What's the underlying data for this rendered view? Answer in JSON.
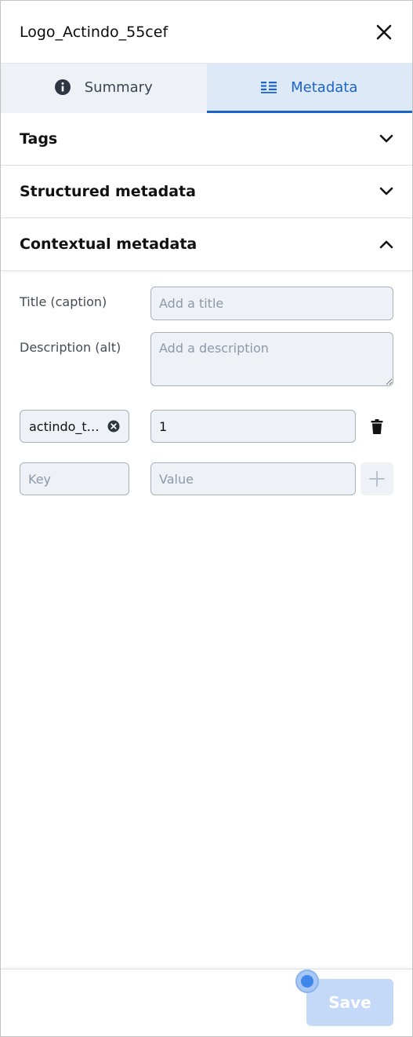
{
  "header": {
    "title": "Logo_Actindo_55cef"
  },
  "tabs": [
    {
      "label": "Summary",
      "icon": "info-icon",
      "active": false
    },
    {
      "label": "Metadata",
      "icon": "list-icon",
      "active": true
    }
  ],
  "sections": [
    {
      "title": "Tags",
      "expanded": false
    },
    {
      "title": "Structured metadata",
      "expanded": false
    },
    {
      "title": "Contextual metadata",
      "expanded": true
    }
  ],
  "contextual": {
    "title_label": "Title (caption)",
    "title_placeholder": "Add a title",
    "title_value": "",
    "description_label": "Description (alt)",
    "description_placeholder": "Add a description",
    "description_value": "",
    "entries": [
      {
        "key": "actindo_t…",
        "value": "1"
      }
    ],
    "new_entry": {
      "key_placeholder": "Key",
      "value_placeholder": "Value"
    }
  },
  "footer": {
    "save_label": "Save"
  },
  "colors": {
    "accent": "#1c64c8",
    "save_disabled": "#c4d9f7",
    "field_bg": "#eef2f7"
  }
}
